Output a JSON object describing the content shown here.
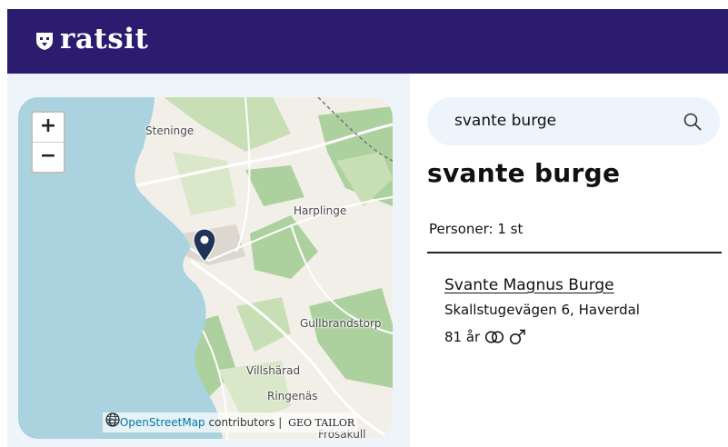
{
  "header": {
    "logo_text": "ratsit",
    "logo_icon": "shield-emblem-icon",
    "background": "#2b1c6f"
  },
  "map": {
    "zoom_in": "+",
    "zoom_out": "−",
    "places": [
      "Steninge",
      "Harplinge",
      "Gullbrandstorp",
      "Villshärad",
      "Ringenäs",
      "Frösakull"
    ],
    "attribution": {
      "copyright": "©",
      "link": "OpenStreetMap",
      "suffix": "contributors |",
      "provider": "GEO TAILOR"
    },
    "marker_icon": "map-pin-icon",
    "colors": {
      "water": "#aad3df",
      "forest": "#add19e",
      "land": "#f2efe9",
      "marker": "#1f3458"
    }
  },
  "search": {
    "value": "svante burge",
    "icon": "search-icon"
  },
  "results": {
    "title": "svante burge",
    "count_label": "Personer: 1 st",
    "items": [
      {
        "name": "Svante Magnus Burge",
        "address": "Skallstugevägen 6, Haverdal",
        "age": "81 år",
        "marital_icon": "married-rings-icon",
        "gender_icon": "male-icon"
      }
    ]
  }
}
